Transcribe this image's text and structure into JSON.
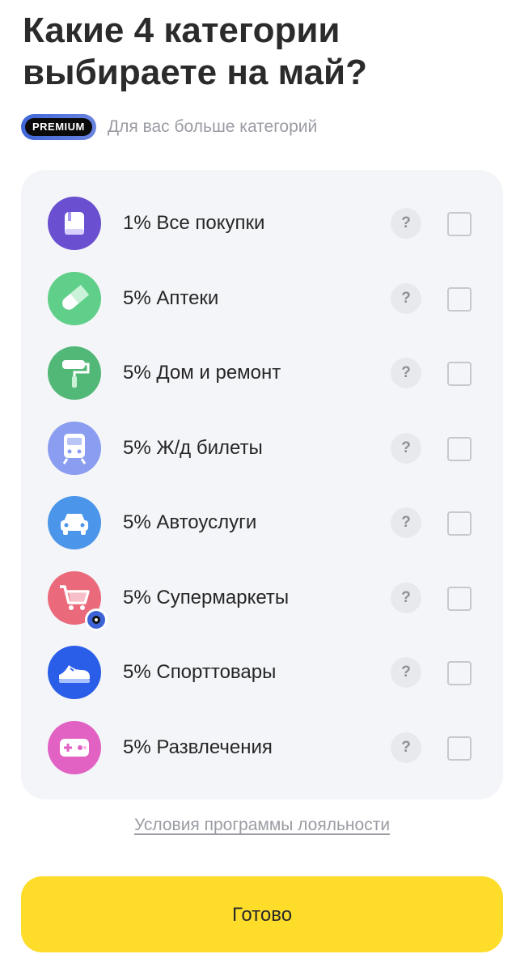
{
  "header": {
    "title": "Какие 4 категории выбираете на май?"
  },
  "premium": {
    "badge": "PREMIUM",
    "text": "Для вас больше категорий"
  },
  "categories": [
    {
      "label": "1% Все покупки",
      "icon": "bag-icon",
      "color": "#6a4fd0",
      "checked": false
    },
    {
      "label": "5% Аптеки",
      "icon": "pill-icon",
      "color": "#5fcf8a",
      "checked": false
    },
    {
      "label": "5% Дом и ремонт",
      "icon": "paint-roller-icon",
      "color": "#52b877",
      "checked": false
    },
    {
      "label": "5% Ж/д билеты",
      "icon": "train-icon",
      "color": "#8a9df0",
      "checked": false
    },
    {
      "label": "5% Автоуслуги",
      "icon": "car-icon",
      "color": "#4b96ea",
      "checked": false
    },
    {
      "label": "5% Супермаркеты",
      "icon": "cart-icon",
      "color": "#ea6a7b",
      "checked": false
    },
    {
      "label": "5% Спорттовары",
      "icon": "sneaker-icon",
      "color": "#2a5ee8",
      "checked": false
    },
    {
      "label": "5% Развлечения",
      "icon": "gamepad-icon",
      "color": "#e262c4",
      "checked": false
    }
  ],
  "help_label": "?",
  "footer": {
    "loyalty_link": "Условия программы лояльности",
    "done_label": "Готово"
  },
  "colors": {
    "accent_yellow": "#fddc2a",
    "card_bg": "#f4f5f8",
    "premium_blue": "#3f67d8"
  }
}
